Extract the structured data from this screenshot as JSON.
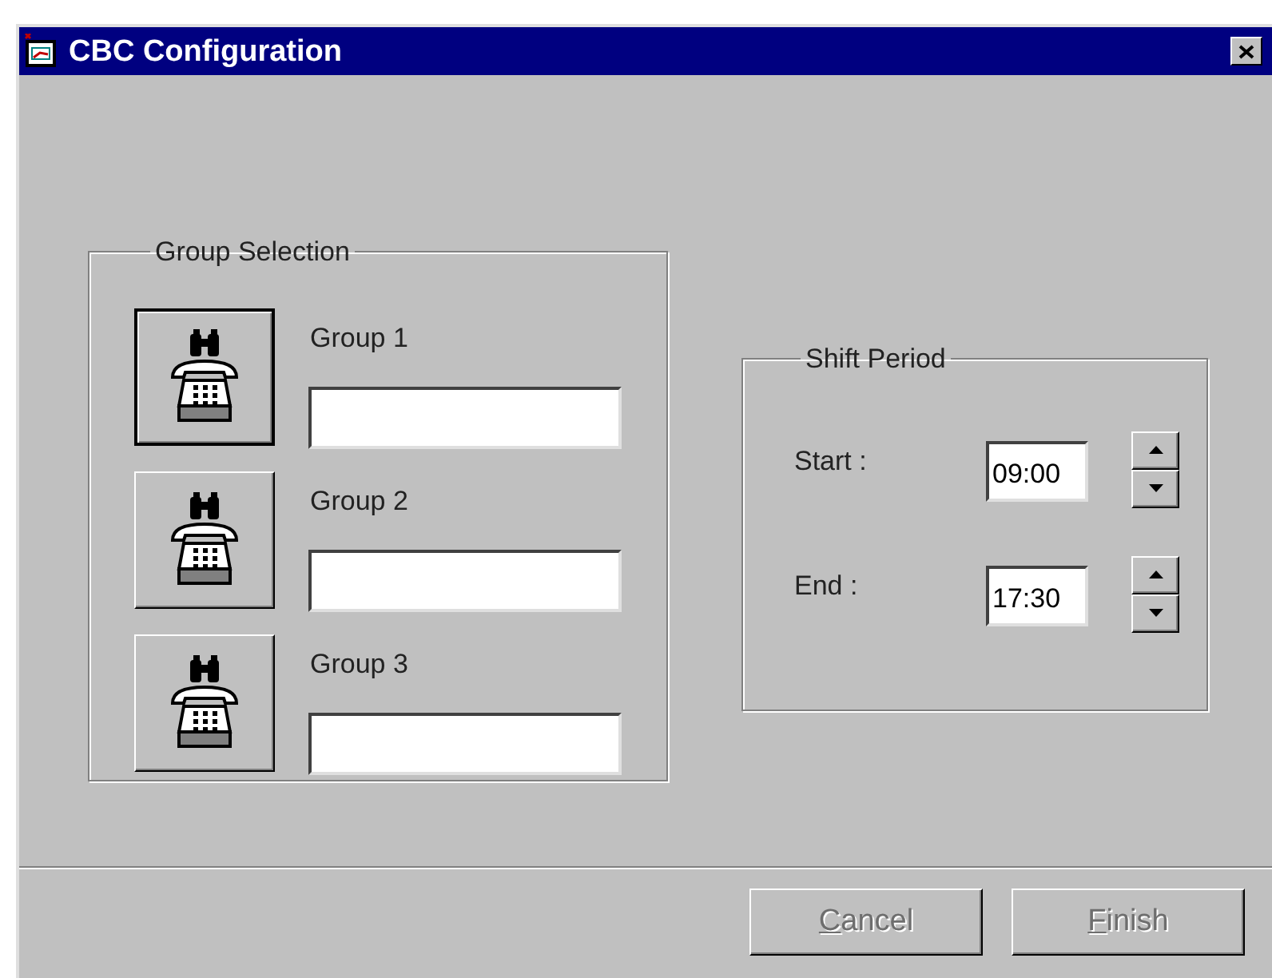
{
  "window": {
    "title": "CBC Configuration"
  },
  "group_selection": {
    "title": "Group Selection",
    "groups": [
      {
        "label": "Group 1",
        "focused": true
      },
      {
        "label": "Group 2",
        "focused": false
      },
      {
        "label": "Group 3",
        "focused": false
      }
    ]
  },
  "shift_period": {
    "title": "Shift Period",
    "fields": [
      {
        "label": "Start :",
        "value": "09:00"
      },
      {
        "label": "End :",
        "value": "17:30"
      }
    ]
  },
  "buttons": [
    {
      "label": "Cancel",
      "disabled": true,
      "access_key_underlined": true
    },
    {
      "label": "Finish",
      "disabled": true,
      "access_key_underlined": true
    }
  ]
}
